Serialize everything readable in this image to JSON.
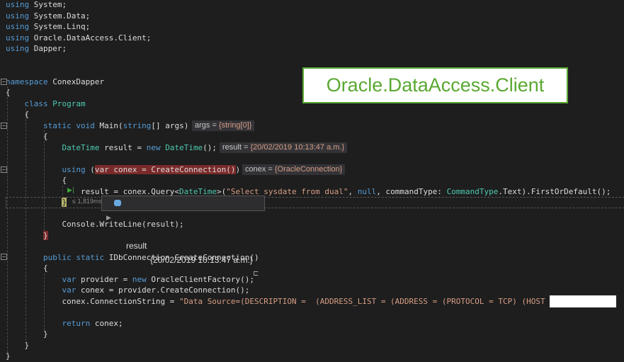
{
  "annotation": "Oracle.DataAccess.Client",
  "code_lines": [
    {
      "row": 0,
      "tokens": [
        [
          "using",
          "kw"
        ],
        [
          " System;",
          "tx"
        ]
      ]
    },
    {
      "row": 1,
      "tokens": [
        [
          "using",
          "kw"
        ],
        [
          " System.Data;",
          "tx"
        ]
      ]
    },
    {
      "row": 2,
      "tokens": [
        [
          "using",
          "kw"
        ],
        [
          " System.Linq;",
          "tx"
        ]
      ]
    },
    {
      "row": 3,
      "tokens": [
        [
          "using",
          "kw"
        ],
        [
          " Oracle.DataAccess.Client;",
          "tx"
        ]
      ]
    },
    {
      "row": 4,
      "tokens": [
        [
          "using",
          "kw"
        ],
        [
          " Dapper;",
          "tx"
        ]
      ]
    },
    {
      "row": 7,
      "tokens": [
        [
          "namespace",
          "kw"
        ],
        [
          " ConexDapper",
          "tx"
        ]
      ]
    },
    {
      "row": 8,
      "tokens": [
        [
          "{",
          "tx"
        ]
      ]
    },
    {
      "row": 9,
      "tokens": [
        [
          "    ",
          "tx"
        ],
        [
          "class",
          "kw"
        ],
        [
          " ",
          "tx"
        ],
        [
          "Program",
          "ty"
        ]
      ]
    },
    {
      "row": 10,
      "tokens": [
        [
          "    {",
          "tx"
        ]
      ]
    },
    {
      "row": 11,
      "tokens": [
        [
          "        ",
          "tx"
        ],
        [
          "static void",
          "kw"
        ],
        [
          " Main(",
          "tx"
        ],
        [
          "string",
          "kw"
        ],
        [
          "[] args)",
          "tx"
        ]
      ]
    },
    {
      "row": 12,
      "tokens": [
        [
          "        {",
          "tx"
        ]
      ]
    },
    {
      "row": 13,
      "tokens": [
        [
          "            ",
          "tx"
        ],
        [
          "DateTime",
          "ty"
        ],
        [
          " result = ",
          "tx"
        ],
        [
          "new",
          "kw"
        ],
        [
          " ",
          "tx"
        ],
        [
          "DateTime",
          "ty"
        ],
        [
          "();",
          "tx"
        ]
      ]
    },
    {
      "row": 15,
      "tokens": [
        [
          "            ",
          "tx"
        ],
        [
          "using",
          "kw"
        ],
        [
          " (",
          "tx"
        ],
        [
          "var conex = CreateConnection()",
          "hl"
        ],
        [
          ")",
          "tx"
        ]
      ]
    },
    {
      "row": 16,
      "tokens": [
        [
          "            {",
          "tx"
        ]
      ]
    },
    {
      "row": 17,
      "tokens": [
        [
          "                result = conex.Query<",
          "tx"
        ],
        [
          "DateTime",
          "ty"
        ],
        [
          ">(",
          "tx"
        ],
        [
          "\"Select sysdate from dual\"",
          "st"
        ],
        [
          ", ",
          "tx"
        ],
        [
          "null",
          "kw"
        ],
        [
          ", commandType: ",
          "tx"
        ],
        [
          "CommandType",
          "ty"
        ],
        [
          ".Text).FirstOrDefault();",
          "tx"
        ]
      ]
    },
    {
      "row": 18,
      "tokens": [
        [
          "            ",
          "tx"
        ],
        [
          "}",
          "yb"
        ]
      ]
    },
    {
      "row": 20,
      "tokens": [
        [
          "            Console.WriteLine(result);",
          "tx"
        ]
      ]
    },
    {
      "row": 21,
      "tokens": [
        [
          "        ",
          "tx"
        ],
        [
          "}",
          "hl"
        ]
      ]
    },
    {
      "row": 23,
      "tokens": [
        [
          "        ",
          "tx"
        ],
        [
          "public static",
          "kw"
        ],
        [
          " IDbConnection CreateConnection()",
          "tx"
        ]
      ]
    },
    {
      "row": 24,
      "tokens": [
        [
          "        {",
          "tx"
        ]
      ]
    },
    {
      "row": 25,
      "tokens": [
        [
          "            ",
          "tx"
        ],
        [
          "var",
          "kw"
        ],
        [
          " provider = ",
          "tx"
        ],
        [
          "new",
          "kw"
        ],
        [
          " OracleClientFactory();",
          "tx"
        ]
      ]
    },
    {
      "row": 26,
      "tokens": [
        [
          "            ",
          "tx"
        ],
        [
          "var",
          "kw"
        ],
        [
          " conex = provider.CreateConnection();",
          "tx"
        ]
      ]
    },
    {
      "row": 27,
      "tokens": [
        [
          "            conex.ConnectionString = ",
          "tx"
        ],
        [
          "\"Data Source=(DESCRIPTION =  (ADDRESS_LIST = (ADDRESS = (PROTOCOL = TCP) (HOST =               )(",
          "st"
        ]
      ]
    },
    {
      "row": 29,
      "tokens": [
        [
          "            ",
          "tx"
        ],
        [
          "return",
          "kw"
        ],
        [
          " conex;",
          "tx"
        ]
      ]
    },
    {
      "row": 30,
      "tokens": [
        [
          "        }",
          "tx"
        ]
      ]
    },
    {
      "row": 31,
      "tokens": [
        [
          "    }",
          "tx"
        ]
      ]
    },
    {
      "row": 32,
      "tokens": [
        [
          "}",
          "tx"
        ]
      ]
    }
  ],
  "datatips": {
    "args": {
      "name": "args = ",
      "value": "{string[0]}"
    },
    "result": {
      "name": "result = ",
      "value": "{20/02/2019 10:13:47 a.m.}"
    },
    "conex": {
      "name": "conex = ",
      "value": "{OracleConnection}"
    }
  },
  "perf_tip": "≤ 1,819ms",
  "popup": {
    "name": "result",
    "value": "{20/02/2019 10:13:47 a.m.}"
  }
}
